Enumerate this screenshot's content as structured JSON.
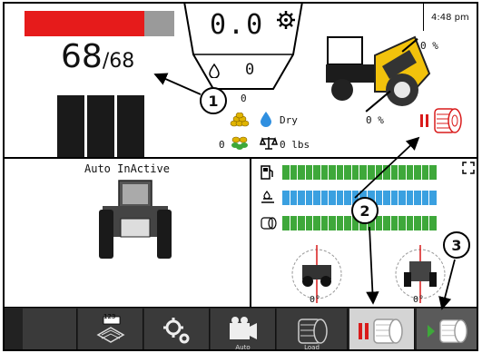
{
  "status": {
    "time": "4:48 pm",
    "speed": "0.0",
    "fuel_value": "0",
    "bales_total": "68",
    "bales_target": "/68",
    "progress_fraction": 0.8
  },
  "harvest": {
    "count_a": "0",
    "count_b": "0",
    "moisture_label": "Dry",
    "weight": "0 lbs"
  },
  "machine": {
    "top_percent": "0 %",
    "bottom_percent": "0 %"
  },
  "left_panel": {
    "title": "Auto InActive"
  },
  "gauges": {
    "left_angle": "0°",
    "right_angle": "0°"
  },
  "toolbar": {
    "auto_label": "Auto",
    "load_label": "Load",
    "counter_label": "123"
  },
  "callouts": {
    "one": "1",
    "two": "2",
    "three": "3"
  },
  "colors": {
    "red_bar": "#e61b1b",
    "green_bar": "#3ea83a",
    "blue_bar": "#3aa0e0",
    "toolbar_bg": "#3a3a3a",
    "toolbar_active": "#d4d4d4",
    "machine_yellow": "#f2c20c"
  },
  "icons": {
    "settings": "gear-icon",
    "camera": "camera-icon",
    "bale": "bale-roll-icon",
    "fullscreen": "expand-icon"
  }
}
